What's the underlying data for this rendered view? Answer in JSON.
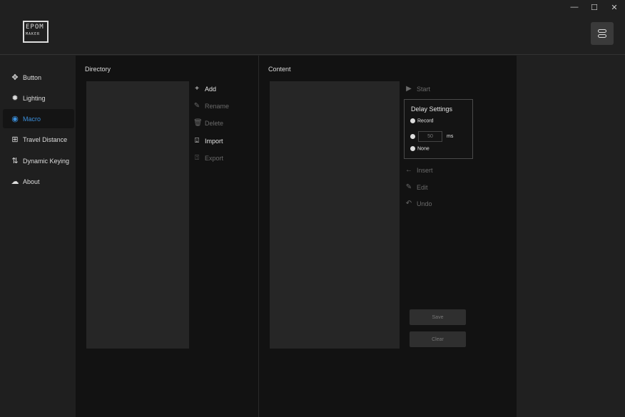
{
  "window": {
    "minimize": "—",
    "maximize": "☐",
    "close": "✕"
  },
  "logo": {
    "top": "EPOM",
    "bottom": "MAKER"
  },
  "sidebar": {
    "items": [
      {
        "label": "Button",
        "icon": "dpad-icon"
      },
      {
        "label": "Lighting",
        "icon": "sun-icon"
      },
      {
        "label": "Macro",
        "icon": "record-icon",
        "active": true
      },
      {
        "label": "Travel Distance",
        "icon": "travel-icon"
      },
      {
        "label": "Dynamic Keying",
        "icon": "dynamic-keying-icon"
      },
      {
        "label": "About",
        "icon": "cloud-download-icon"
      }
    ]
  },
  "accent": "#3b8fdb",
  "directory": {
    "title": "Directory",
    "actions": [
      {
        "label": "Add",
        "icon": "plus-icon",
        "enabled": true
      },
      {
        "label": "Rename",
        "icon": "pencil-icon",
        "enabled": false
      },
      {
        "label": "Delete",
        "icon": "trash-icon",
        "enabled": false
      },
      {
        "label": "Import",
        "icon": "import-icon",
        "enabled": true
      },
      {
        "label": "Export",
        "icon": "export-icon",
        "enabled": false
      }
    ]
  },
  "content": {
    "title": "Content",
    "start": "Start",
    "delay": {
      "title": "Delay Settings",
      "record": "Record",
      "value": "50",
      "unit": "ms",
      "none": "None"
    },
    "actions": [
      {
        "label": "Insert",
        "icon": "arrow-left-icon"
      },
      {
        "label": "Edit",
        "icon": "pencil-icon"
      },
      {
        "label": "Undo",
        "icon": "undo-icon"
      }
    ],
    "save": "Save",
    "clear": "Clear"
  }
}
